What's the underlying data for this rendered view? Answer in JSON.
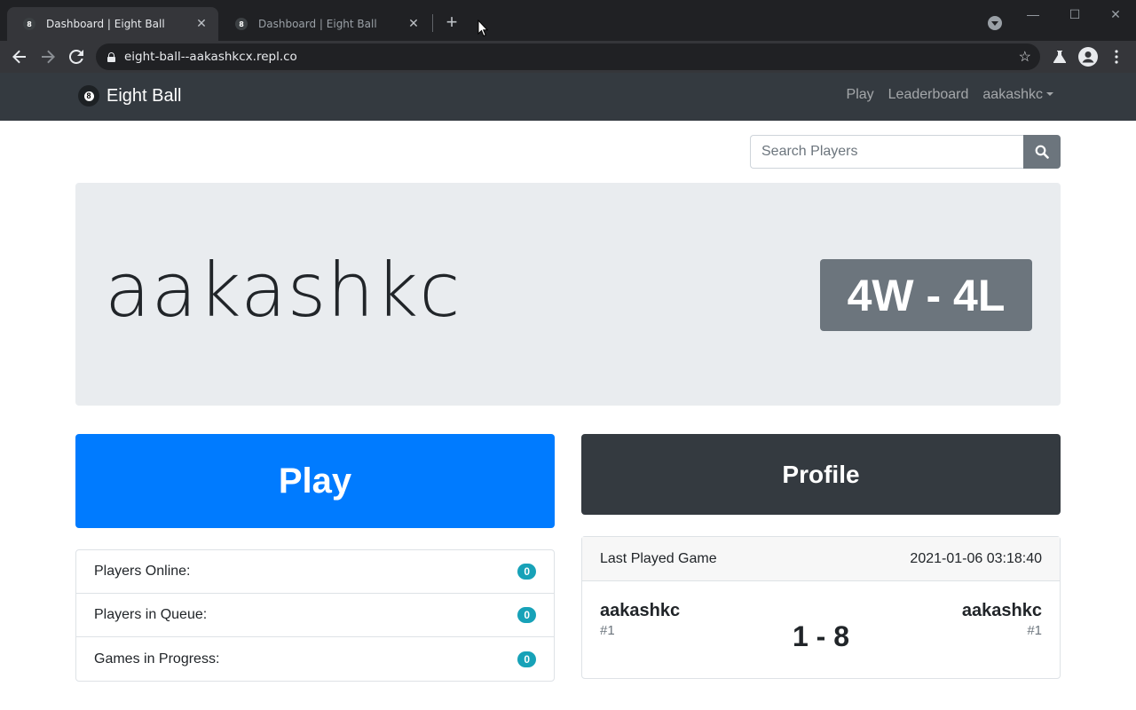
{
  "browser": {
    "tabs": [
      {
        "title": "Dashboard | Eight Ball",
        "active": true
      },
      {
        "title": "Dashboard | Eight Ball",
        "active": false
      }
    ],
    "url": "eight-ball--aakashkcx.repl.co"
  },
  "navbar": {
    "brand": "Eight Ball",
    "links": {
      "play": "Play",
      "leaderboard": "Leaderboard",
      "user": "aakashkc"
    }
  },
  "search": {
    "placeholder": "Search Players"
  },
  "hero": {
    "username": "aakashkc",
    "record": "4W - 4L"
  },
  "actions": {
    "play": "Play",
    "profile": "Profile"
  },
  "stats": [
    {
      "label": "Players Online:",
      "value": "0"
    },
    {
      "label": "Players in Queue:",
      "value": "0"
    },
    {
      "label": "Games in Progress:",
      "value": "0"
    }
  ],
  "last_game": {
    "heading": "Last Played Game",
    "timestamp": "2021-01-06 03:18:40",
    "player1": {
      "name": "aakashkc",
      "rank": "#1"
    },
    "player2": {
      "name": "aakashkc",
      "rank": "#1"
    },
    "score": "1 - 8"
  },
  "colors": {
    "primary": "#007bff",
    "dark": "#343a40",
    "secondary": "#6c757d",
    "info": "#17a2b8"
  }
}
